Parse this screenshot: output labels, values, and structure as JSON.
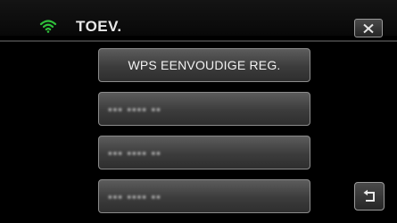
{
  "header": {
    "title": "TOEV.",
    "wifi_icon": "wifi-icon",
    "close_icon": "close-icon",
    "accent_color": "#2fbf3a"
  },
  "menu": {
    "items": [
      {
        "label": "WPS EENVOUDIGE REG."
      },
      {
        "label": "▪▪▪ ▪▪▪▪ ▪▪"
      },
      {
        "label": "▪▪▪ ▪▪▪▪ ▪▪"
      },
      {
        "label": "▪▪▪ ▪▪▪▪ ▪▪"
      }
    ]
  },
  "footer": {
    "return_icon": "return-icon"
  }
}
